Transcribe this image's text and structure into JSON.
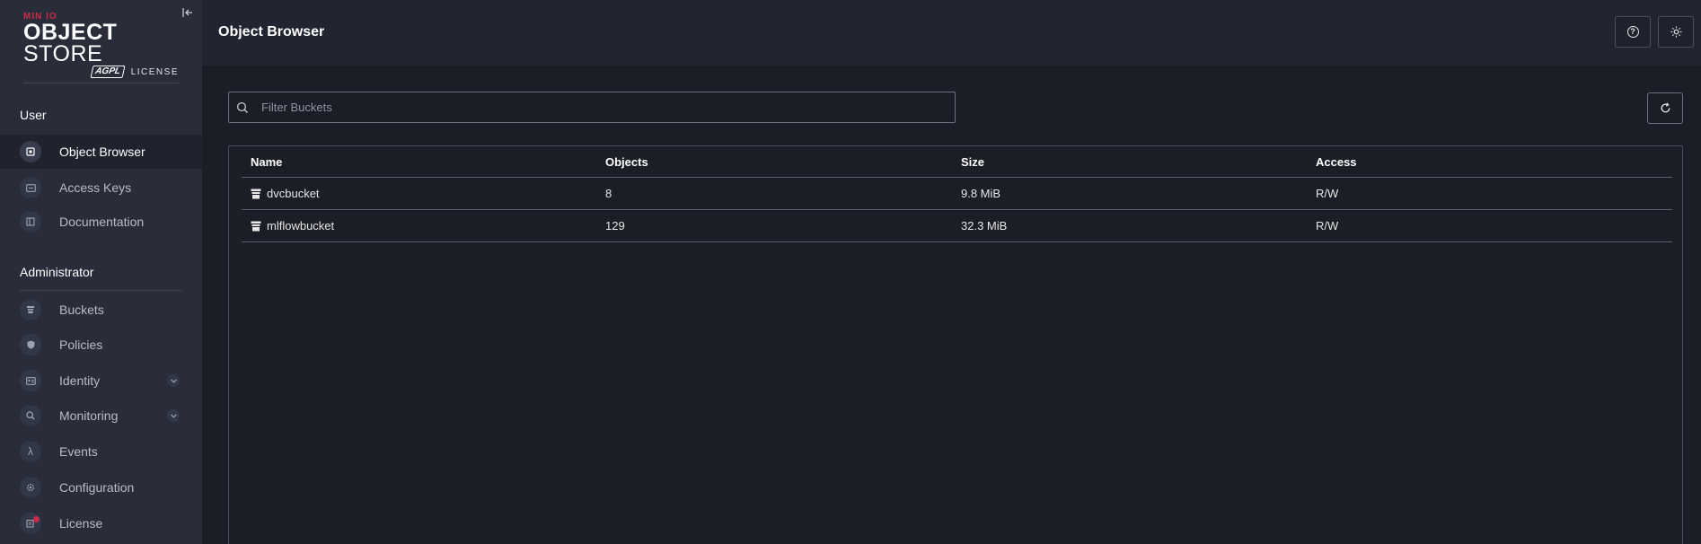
{
  "sidebar": {
    "logo": {
      "brand": "MIN IO",
      "title_bold": "OBJECT",
      "title_rest": " STORE",
      "badge": "AGPL",
      "license": "LICENSE"
    },
    "user_section": "User",
    "admin_section": "Administrator",
    "user_items": [
      {
        "label": "Object Browser",
        "icon": "object-browser-icon"
      },
      {
        "label": "Access Keys",
        "icon": "access-keys-icon"
      },
      {
        "label": "Documentation",
        "icon": "documentation-icon"
      }
    ],
    "admin_items": [
      {
        "label": "Buckets",
        "icon": "buckets-icon"
      },
      {
        "label": "Policies",
        "icon": "policies-icon"
      },
      {
        "label": "Identity",
        "icon": "identity-icon"
      },
      {
        "label": "Monitoring",
        "icon": "monitoring-icon"
      },
      {
        "label": "Events",
        "icon": "lambda-icon"
      },
      {
        "label": "Configuration",
        "icon": "gear-icon"
      },
      {
        "label": "License",
        "icon": "license-icon"
      }
    ]
  },
  "header": {
    "title": "Object Browser"
  },
  "search": {
    "placeholder": "Filter Buckets",
    "value": ""
  },
  "table": {
    "columns": [
      "Name",
      "Objects",
      "Size",
      "Access"
    ],
    "rows": [
      {
        "name": "dvcbucket",
        "objects": "8",
        "size": "9.8 MiB",
        "access": "R/W"
      },
      {
        "name": "mlflowbucket",
        "objects": "129",
        "size": "32.3 MiB",
        "access": "R/W"
      }
    ]
  },
  "colors": {
    "accent": "#c72c48",
    "sidebar_bg": "#292d3a",
    "main_bg": "#1c1e27",
    "topbar_bg": "#222531"
  }
}
